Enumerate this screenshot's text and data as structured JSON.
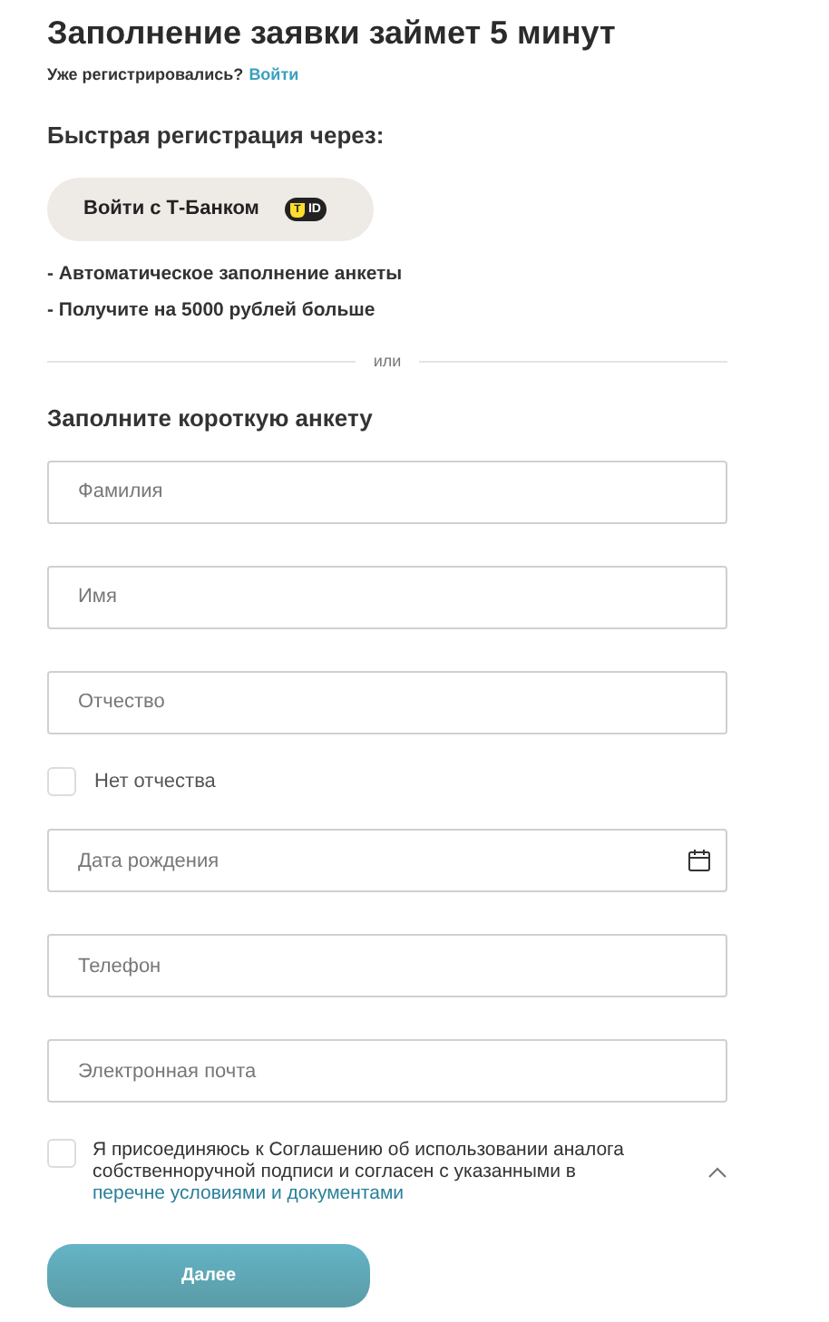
{
  "title": "Заполнение заявки займет 5 минут",
  "login_prompt": {
    "text": "Уже регистрировались?",
    "link": "Войти"
  },
  "quick_registration": {
    "heading": "Быстрая регистрация через:",
    "button": "Войти с Т-Банком",
    "badge_letter": "T",
    "badge_text": "ID",
    "benefits": [
      "- Автоматическое заполнение анкеты",
      "- Получите на 5000 рублей больше"
    ]
  },
  "divider_text": "или",
  "form_heading": "Заполните короткую анкету",
  "form_items": [
    {
      "kind": "field",
      "placeholder": "Фамилия"
    },
    {
      "kind": "field",
      "placeholder": "Имя"
    },
    {
      "kind": "field",
      "placeholder": "Отчество"
    },
    {
      "kind": "checkbox",
      "label": "Нет отчества",
      "checked": false
    },
    {
      "kind": "date",
      "placeholder": "Дата рождения"
    },
    {
      "kind": "field",
      "placeholder": "Телефон"
    },
    {
      "kind": "field",
      "placeholder": "Электронная почта"
    }
  ],
  "agreement": {
    "checked": false,
    "text": "Я присоединяюсь к Соглашению об использовании аналога собственноручной подписи и согласен с указанными в",
    "link": "перечне условиями и документами",
    "expanded": true
  },
  "submit_button": "Далее"
}
